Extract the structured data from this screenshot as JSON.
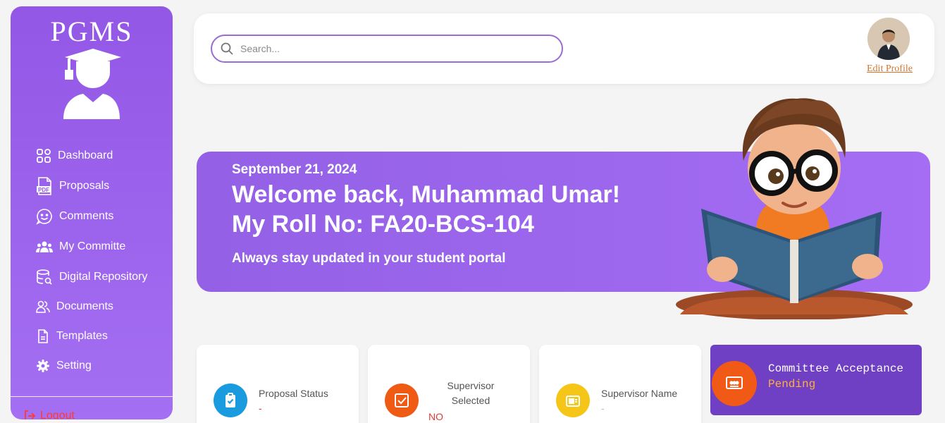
{
  "brand": "PGMS",
  "sidebar": {
    "items": [
      {
        "label": "Dashboard",
        "icon": "grid-icon"
      },
      {
        "label": "Proposals",
        "icon": "pdf-icon"
      },
      {
        "label": "Comments",
        "icon": "smiley-icon"
      },
      {
        "label": "My Committe",
        "icon": "group-icon"
      },
      {
        "label": "Digital Repository",
        "icon": "database-search-icon"
      },
      {
        "label": "Documents",
        "icon": "users-icon"
      },
      {
        "label": "Templates",
        "icon": "file-icon"
      },
      {
        "label": "Setting",
        "icon": "gear-icon"
      }
    ],
    "logout": "Logout"
  },
  "header": {
    "search_placeholder": "Search...",
    "edit_profile": "Edit Profile"
  },
  "banner": {
    "date": "September 21, 2024",
    "welcome": "Welcome back, Muhammad Umar!",
    "roll": "My Roll No: FA20-BCS-104",
    "subtitle": "Always stay updated in your student portal"
  },
  "cards": {
    "proposal_status": {
      "label": "Proposal Status",
      "value": "-"
    },
    "supervisor_selected": {
      "label": "Supervisor Selected",
      "value": "NO"
    },
    "supervisor_name": {
      "label": "Supervisor Name",
      "value": "-"
    },
    "committee_acceptance": {
      "label": "Committee Acceptance",
      "value": "Pending"
    }
  },
  "colors": {
    "sidebar": "#9357e6",
    "banner": "#9b66ec",
    "accent_orange": "#f05a16",
    "accept_card": "#6f3fc4"
  }
}
